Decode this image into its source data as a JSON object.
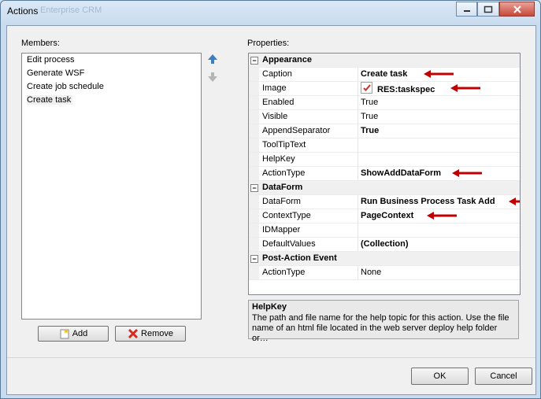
{
  "window": {
    "title": "Actions",
    "ghost_title": "Enterprise CRM"
  },
  "members": {
    "label": "Members:",
    "items": [
      "Edit process",
      "Generate WSF",
      "Create job schedule",
      "Create task"
    ],
    "add_label": "Add",
    "remove_label": "Remove"
  },
  "properties": {
    "label": "Properties:",
    "rows": [
      {
        "type": "cat",
        "name": "Appearance"
      },
      {
        "name": "Caption",
        "value": "Create task",
        "bold": true,
        "arrow": true
      },
      {
        "name": "Image",
        "value": "RES:taskspec",
        "bold": true,
        "icon": true,
        "arrow": true
      },
      {
        "name": "Enabled",
        "value": "True"
      },
      {
        "name": "Visible",
        "value": "True"
      },
      {
        "name": "AppendSeparator",
        "value": "True",
        "bold": true
      },
      {
        "name": "ToolTipText",
        "value": ""
      },
      {
        "name": "HelpKey",
        "value": ""
      },
      {
        "name": "ActionType",
        "value": "ShowAddDataForm",
        "bold": true,
        "arrow": true
      },
      {
        "type": "cat",
        "name": "DataForm"
      },
      {
        "name": "DataForm",
        "value": "Run Business Process Task Add",
        "bold": true,
        "arrow": true
      },
      {
        "name": "ContextType",
        "value": "PageContext",
        "bold": true,
        "arrow": true
      },
      {
        "name": "IDMapper",
        "value": ""
      },
      {
        "name": "DefaultValues",
        "value": "(Collection)",
        "bold": true
      },
      {
        "type": "cat",
        "name": "Post-Action Event"
      },
      {
        "name": "ActionType",
        "value": "None"
      }
    ]
  },
  "help": {
    "title": "HelpKey",
    "text": "The path and file name for the help topic for this action.  Use the file name of an html file located in the web server deploy help folder or…"
  },
  "buttons": {
    "ok": "OK",
    "cancel": "Cancel"
  },
  "colors": {
    "arrow": "#c00000",
    "up_arrow": "#3c7fc0"
  }
}
